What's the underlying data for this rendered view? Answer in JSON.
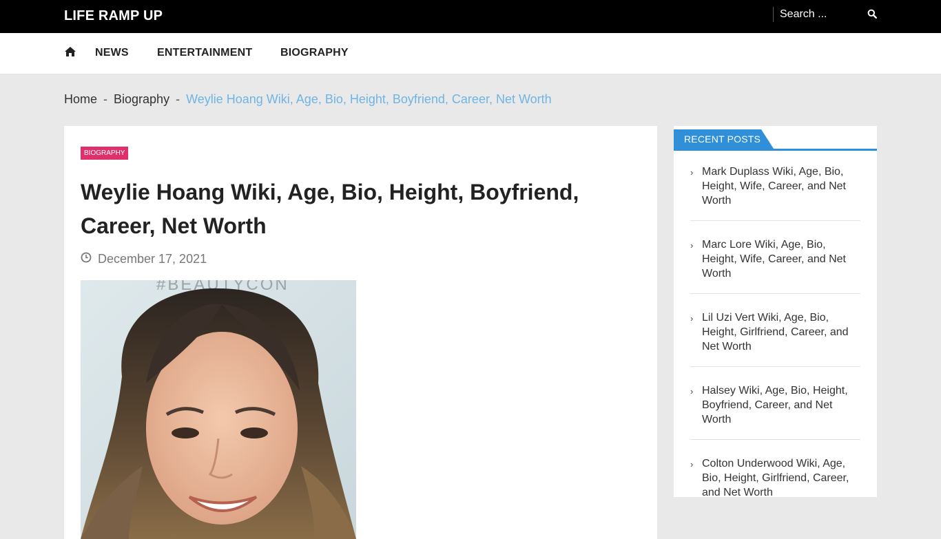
{
  "header": {
    "site_title": "LIFE RAMP UP",
    "search_placeholder": "Search ...",
    "search_icon": "search-icon"
  },
  "nav": {
    "home_icon": "home-icon",
    "items": [
      {
        "label": "NEWS"
      },
      {
        "label": "ENTERTAINMENT"
      },
      {
        "label": "BIOGRAPHY"
      }
    ]
  },
  "breadcrumb": {
    "home": "Home",
    "separator": "-",
    "category": "Biography",
    "current": "Weylie Hoang Wiki, Age, Bio, Height, Boyfriend, Career, Net Worth"
  },
  "article": {
    "category": "BIOGRAPHY",
    "title": "Weylie Hoang Wiki, Age, Bio, Height, Boyfriend, Career, Net Worth",
    "date": "December 17, 2021",
    "date_icon": "clock-icon"
  },
  "sidebar": {
    "widget_title": "RECENT POSTS",
    "posts": [
      {
        "title": "Mark Duplass Wiki, Age, Bio, Height, Wife, Career, and Net Worth"
      },
      {
        "title": "Marc Lore Wiki, Age, Bio, Height, Wife, Career, and Net Worth"
      },
      {
        "title": "Lil Uzi Vert Wiki, Age, Bio, Height, Girlfriend, Career, and Net Worth"
      },
      {
        "title": "Halsey Wiki, Age, Bio, Height, Boyfriend, Career, and Net Worth"
      },
      {
        "title": "Colton Underwood Wiki, Age, Bio, Height, Girlfriend, Career, and Net Worth"
      }
    ]
  },
  "colors": {
    "topbar": "#000000",
    "accent_blue": "#2f8fd8",
    "badge_pink": "#e0306b",
    "breadcrumb_current": "#6fb4e4",
    "page_bg": "#e9e9e9"
  }
}
